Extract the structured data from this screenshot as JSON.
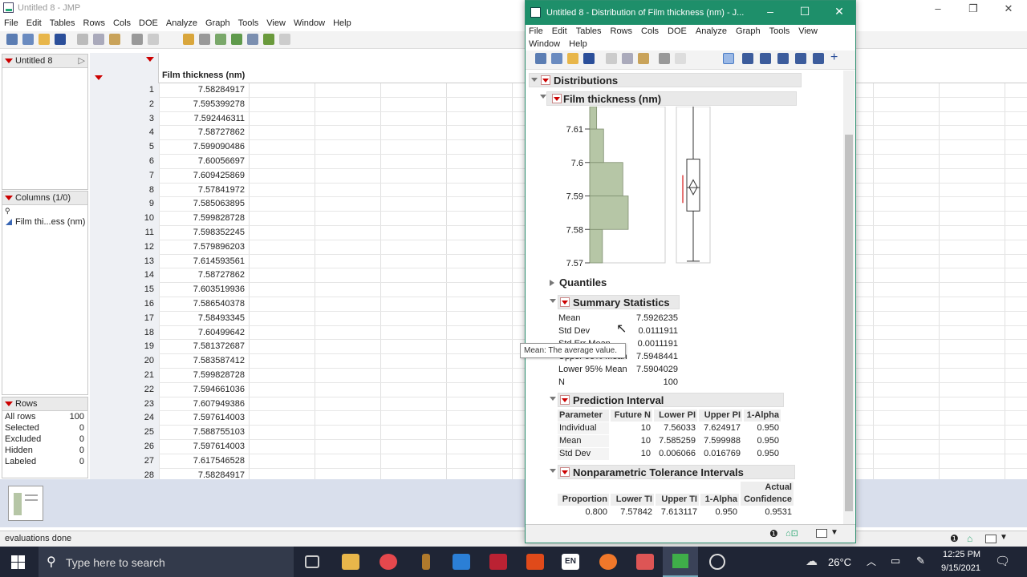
{
  "main_window": {
    "title": "Untitled 8 - JMP",
    "menu": [
      "File",
      "Edit",
      "Tables",
      "Rows",
      "Cols",
      "DOE",
      "Analyze",
      "Graph",
      "Tools",
      "View",
      "Window",
      "Help"
    ]
  },
  "table_panel": {
    "label": "Untitled 8"
  },
  "columns_panel": {
    "label": "Columns (1/0)",
    "search_icon": "search-icon",
    "items": [
      "Film thi...ess (nm)"
    ]
  },
  "rows_panel": {
    "label": "Rows",
    "items": [
      {
        "name": "All rows",
        "value": "100"
      },
      {
        "name": "Selected",
        "value": "0"
      },
      {
        "name": "Excluded",
        "value": "0"
      },
      {
        "name": "Hidden",
        "value": "0"
      },
      {
        "name": "Labeled",
        "value": "0"
      }
    ]
  },
  "grid": {
    "column_header": "Film thickness (nm)",
    "rows": [
      [
        "1",
        "7.58284917"
      ],
      [
        "2",
        "7.595399278"
      ],
      [
        "3",
        "7.592446311"
      ],
      [
        "4",
        "7.58727862"
      ],
      [
        "5",
        "7.599090486"
      ],
      [
        "6",
        "7.60056697"
      ],
      [
        "7",
        "7.609425869"
      ],
      [
        "8",
        "7.57841972"
      ],
      [
        "9",
        "7.585063895"
      ],
      [
        "10",
        "7.599828728"
      ],
      [
        "11",
        "7.598352245"
      ],
      [
        "12",
        "7.579896203"
      ],
      [
        "13",
        "7.614593561"
      ],
      [
        "14",
        "7.58727862"
      ],
      [
        "15",
        "7.603519936"
      ],
      [
        "16",
        "7.586540378"
      ],
      [
        "17",
        "7.58493345"
      ],
      [
        "18",
        "7.60499642"
      ],
      [
        "19",
        "7.581372687"
      ],
      [
        "20",
        "7.583587412"
      ],
      [
        "21",
        "7.599828728"
      ],
      [
        "22",
        "7.594661036"
      ],
      [
        "23",
        "7.607949386"
      ],
      [
        "24",
        "7.597614003"
      ],
      [
        "25",
        "7.588755103"
      ],
      [
        "26",
        "7.597614003"
      ],
      [
        "27",
        "7.617546528"
      ],
      [
        "28",
        "7.58284917"
      ]
    ]
  },
  "status": {
    "text": "evaluations done"
  },
  "report_window": {
    "title": "Untitled 8 - Distribution of Film thickness (nm) - J...",
    "menu": [
      "File",
      "Edit",
      "Tables",
      "Rows",
      "Cols",
      "DOE",
      "Analyze",
      "Graph",
      "Tools",
      "View",
      "Window",
      "Help"
    ],
    "outline": {
      "distributions": "Distributions",
      "film_thickness": "Film thickness (nm)",
      "quantiles": "Quantiles",
      "summary_statistics": "Summary Statistics",
      "prediction_interval": "Prediction Interval",
      "nonparametric": "Nonparametric Tolerance Intervals"
    }
  },
  "chart_data": {
    "type": "bar",
    "orientation": "horizontal histogram",
    "y_ticks": [
      "7.61",
      "7.6",
      "7.59",
      "7.58",
      "7.57"
    ],
    "bins": [
      {
        "range": [
          7.57,
          7.58
        ],
        "relative": 0.33
      },
      {
        "range": [
          7.58,
          7.59
        ],
        "relative": 1.0
      },
      {
        "range": [
          7.59,
          7.6
        ],
        "relative": 0.86
      },
      {
        "range": [
          7.6,
          7.61
        ],
        "relative": 0.36
      },
      {
        "range": [
          7.61,
          7.62
        ],
        "relative": 0.18
      }
    ],
    "ylim": [
      7.57,
      7.62
    ],
    "box": {
      "min": 7.5705,
      "q1": 7.5855,
      "median": 7.5925,
      "q3": 7.601,
      "max": 7.622,
      "mean": 7.5926,
      "ci": [
        7.5904,
        7.5948
      ]
    },
    "bar_color": "#b6c6a6"
  },
  "summary_statistics": [
    {
      "label": "Mean",
      "value": "7.5926235"
    },
    {
      "label": "Std Dev",
      "value": "0.0111911"
    },
    {
      "label": "Std Err Mean",
      "value": "0.0011191"
    },
    {
      "label": "Upper 95% Mean",
      "value": "7.5948441"
    },
    {
      "label": "Lower 95% Mean",
      "value": "7.5904029"
    },
    {
      "label": "N",
      "value": "100"
    }
  ],
  "tooltip": "Mean: The average value.",
  "prediction_interval": {
    "headers": [
      "Parameter",
      "Future N",
      "Lower PI",
      "Upper PI",
      "1-Alpha"
    ],
    "rows": [
      [
        "Individual",
        "10",
        "7.56033",
        "7.624917",
        "0.950"
      ],
      [
        "Mean",
        "10",
        "7.585259",
        "7.599988",
        "0.950"
      ],
      [
        "Std Dev",
        "10",
        "0.006066",
        "0.016769",
        "0.950"
      ]
    ]
  },
  "tolerance_intervals": {
    "headers": [
      "Proportion",
      "Lower TI",
      "Upper TI",
      "1-Alpha",
      "Actual Confidence"
    ],
    "header_line1": "Actual",
    "header_line2": [
      "Proportion",
      "Lower TI",
      "Upper TI",
      "1-Alpha",
      "Confidence"
    ],
    "row": [
      "0.800",
      "7.57842",
      "7.613117",
      "0.950",
      "0.9531"
    ]
  },
  "taskbar": {
    "search_placeholder": "Type here to search",
    "temperature": "26°C",
    "time": "12:25 PM",
    "date": "9/15/2021",
    "lang": "EN"
  }
}
